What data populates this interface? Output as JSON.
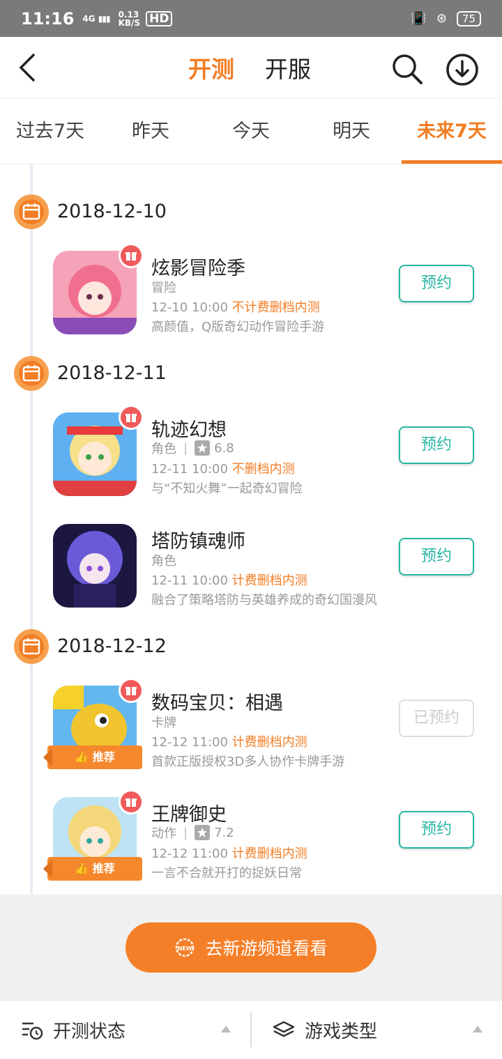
{
  "status": {
    "time": "11:16",
    "net_type": "4G",
    "speed": "0.13",
    "speed_unit": "KB/S",
    "hd": "HD",
    "battery": "75"
  },
  "header": {
    "tab_active": "开测",
    "tab_other": "开服"
  },
  "day_tabs": [
    "过去7天",
    "昨天",
    "今天",
    "明天",
    "未来7天"
  ],
  "groups": [
    {
      "date": "2018-12-10"
    },
    {
      "date": "2018-12-11"
    },
    {
      "date": "2018-12-12"
    }
  ],
  "games": [
    {
      "name": "炫影冒险季",
      "category": "冒险",
      "rating": "",
      "time": "12-10 10:00",
      "test_type": "不计费删档内测",
      "desc": "高颜值，Q版奇幻动作冒险手游",
      "button": "预约",
      "recommend": ""
    },
    {
      "name": "轨迹幻想",
      "category": "角色",
      "rating": "6.8",
      "time": "12-11 10:00",
      "test_type": "不删档内测",
      "desc": "与“不知火舞”一起奇幻冒险",
      "button": "预约",
      "recommend": ""
    },
    {
      "name": "塔防镇魂师",
      "category": "角色",
      "rating": "",
      "time": "12-11 10:00",
      "test_type": "计费删档内测",
      "desc": "融合了策略塔防与英雄养成的奇幻国漫风",
      "button": "预约",
      "recommend": ""
    },
    {
      "name": "数码宝贝：相遇",
      "category": "卡牌",
      "rating": "",
      "time": "12-12 11:00",
      "test_type": "计费删档内测",
      "desc": "首款正版授权3D多人协作卡牌手游",
      "button": "已预约",
      "recommend": "推荐"
    },
    {
      "name": "王牌御史",
      "category": "动作",
      "rating": "7.2",
      "time": "12-12 11:00",
      "test_type": "计费删档内测",
      "desc": "一言不合就开打的捉妖日常",
      "button": "预约",
      "recommend": "推荐"
    }
  ],
  "go_button": {
    "label": "去新游频道看看",
    "badge": "NEW"
  },
  "bottom": {
    "filter1": "开测状态",
    "filter2": "游戏类型"
  },
  "colors": {
    "accent": "#f27d24",
    "teal": "#26b5a3"
  }
}
